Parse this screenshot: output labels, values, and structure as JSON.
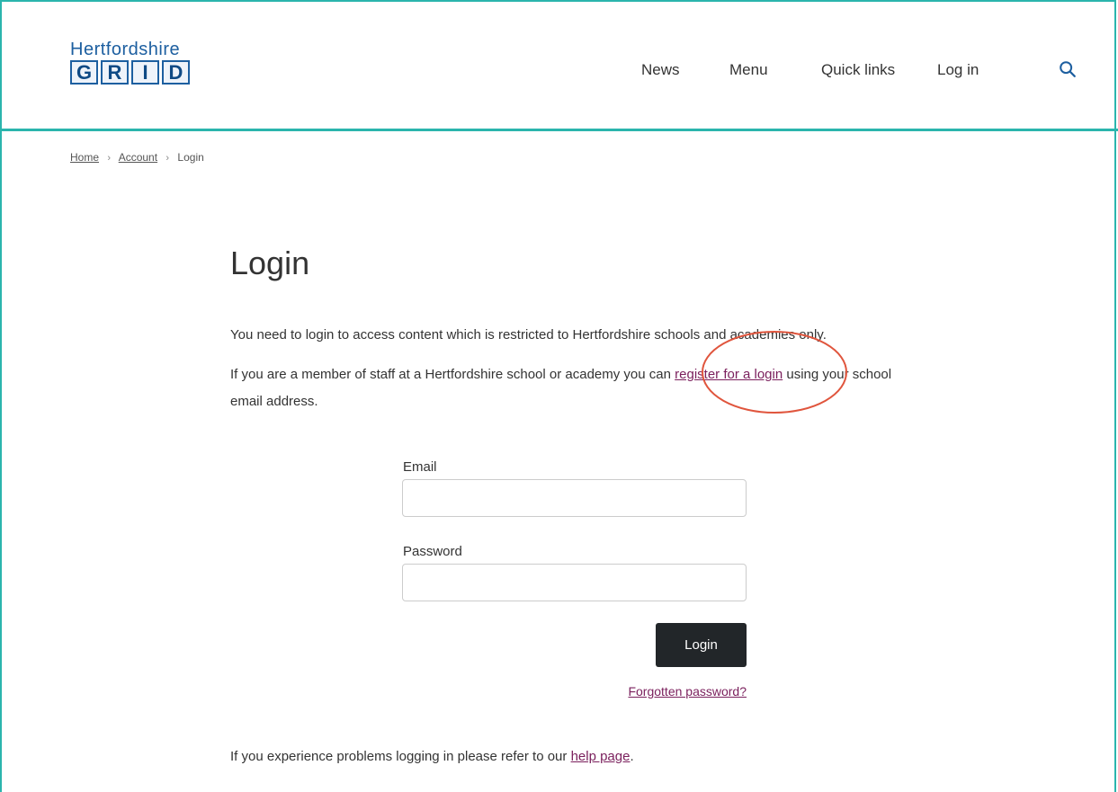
{
  "logo": {
    "top_text": "Hertfordshire",
    "letters": [
      "G",
      "R",
      "I",
      "D"
    ]
  },
  "nav": {
    "news": "News",
    "menu": "Menu",
    "quick_links": "Quick links",
    "log_in": "Log in",
    "search_icon": "search-icon"
  },
  "breadcrumb": {
    "home": "Home",
    "account": "Account",
    "current": "Login",
    "separator": "›"
  },
  "page": {
    "title": "Login",
    "intro": "You need to login to access content which is restricted to Hertfordshire schools and academies only.",
    "register_prefix": "If you are a member of staff at a Hertfordshire school or academy you can ",
    "register_link": "register for a login",
    "register_suffix": " using your school email address.",
    "help_prefix": "If you experience problems logging in please refer to our ",
    "help_link": "help page",
    "help_suffix": "."
  },
  "form": {
    "email_label": "Email",
    "email_value": "",
    "password_label": "Password",
    "password_value": "",
    "login_button": "Login",
    "forgot_link": "Forgotten password?"
  },
  "colors": {
    "accent": "#2bb5ad",
    "brand": "#1d5fa0",
    "link": "#7a1f5c",
    "button": "#222629",
    "annotation": "#e0553d"
  }
}
